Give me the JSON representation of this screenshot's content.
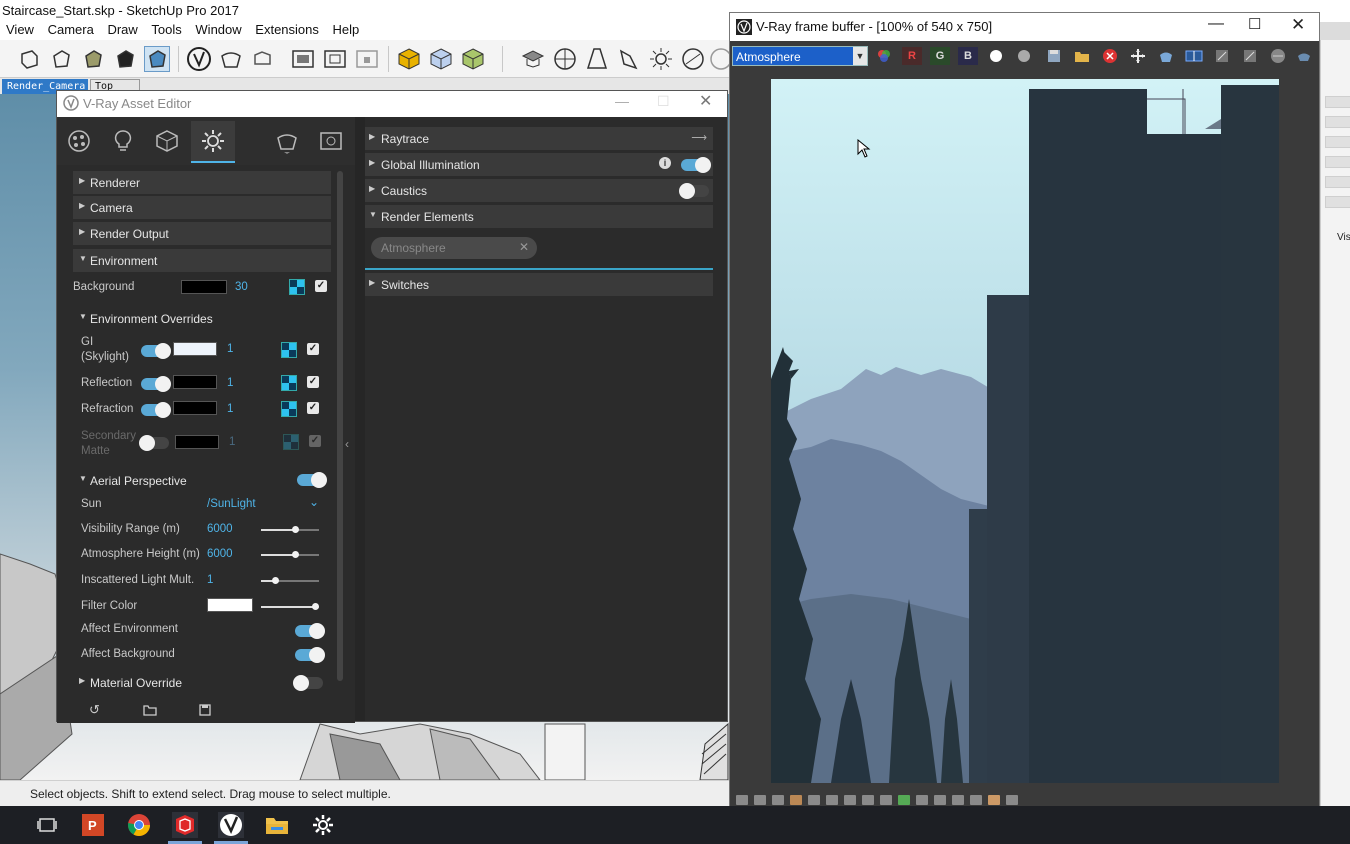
{
  "sketchup": {
    "title": "Staircase_Start.skp - SketchUp Pro 2017",
    "menu": [
      "View",
      "Camera",
      "Draw",
      "Tools",
      "Window",
      "Extensions",
      "Help"
    ],
    "scene_tabs": [
      "Render_Camera",
      "Top View"
    ],
    "status_text": "Select objects. Shift to extend select. Drag mouse to select multiple.",
    "right_panel_label": "Vis"
  },
  "asset_editor": {
    "title": "V-Ray Asset Editor",
    "left_sections": {
      "renderer": "Renderer",
      "camera": "Camera",
      "render_output": "Render Output",
      "environment": "Environment",
      "environment_overrides": "Environment Overrides",
      "aerial_perspective": "Aerial Perspective",
      "material_override": "Material Override"
    },
    "environment": {
      "background_label": "Background",
      "background_value": "30"
    },
    "overrides": {
      "gi_label": "GI\n(Skylight)",
      "gi_value": "1",
      "reflection_label": "Reflection",
      "reflection_value": "1",
      "refraction_label": "Refraction",
      "refraction_value": "1",
      "secondary_label": "Secondary\nMatte",
      "secondary_value": "1"
    },
    "aerial": {
      "sun_label": "Sun",
      "sun_value": "/SunLight",
      "visibility_label": "Visibility Range (m)",
      "visibility_value": "6000",
      "atm_height_label": "Atmosphere Height (m)",
      "atm_height_value": "6000",
      "inscattered_label": "Inscattered Light Mult.",
      "inscattered_value": "1",
      "filter_color_label": "Filter Color",
      "affect_env_label": "Affect Environment",
      "affect_bg_label": "Affect Background"
    },
    "right_sections": {
      "raytrace": "Raytrace",
      "gi": "Global Illumination",
      "caustics": "Caustics",
      "render_elements": "Render Elements",
      "switches": "Switches"
    },
    "render_element_chip": "Atmosphere"
  },
  "frame_buffer": {
    "title": "V-Ray frame buffer - [100% of 540 x 750]",
    "channel": "Atmosphere",
    "channel_buttons": [
      "R",
      "G",
      "B"
    ]
  },
  "colors": {
    "accent_blue": "#4fb4e8",
    "toggle_on": "#5aa9d6",
    "sky": "#cdeef4",
    "building": "#26323c"
  }
}
